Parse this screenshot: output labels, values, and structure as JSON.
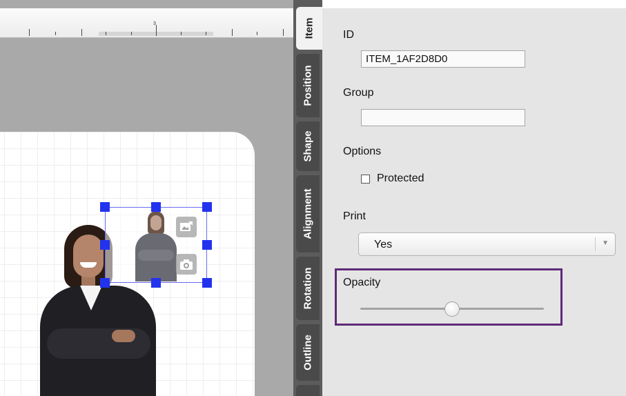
{
  "ruler": {
    "mark_label": "3"
  },
  "tabs": [
    {
      "label": "Item",
      "active": true
    },
    {
      "label": "Position",
      "active": false
    },
    {
      "label": "Shape",
      "active": false
    },
    {
      "label": "Alignment",
      "active": false
    },
    {
      "label": "Rotation",
      "active": false
    },
    {
      "label": "Outline",
      "active": false
    }
  ],
  "props": {
    "id_label": "ID",
    "id_value": "ITEM_1AF2D8D0",
    "group_label": "Group",
    "group_value": "",
    "options_label": "Options",
    "protected_label": "Protected",
    "protected_checked": false,
    "print_label": "Print",
    "print_value": "Yes",
    "opacity_label": "Opacity",
    "opacity_fraction": 0.5
  },
  "colors": {
    "selection_handle": "#2233ee",
    "highlight_border": "#5e2a78",
    "tab_strip": "#5c5c5c"
  },
  "icons": [
    "replace-image-icon",
    "camera-icon",
    "chevron-down-icon"
  ]
}
